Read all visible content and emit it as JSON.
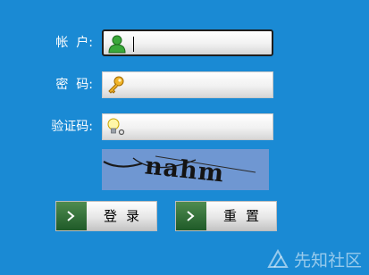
{
  "form": {
    "account_label": "帐  户:",
    "password_label": "密  码:",
    "captcha_label": "验证码:",
    "account_value": "",
    "password_value": "",
    "captcha_value": ""
  },
  "icons": {
    "account": "user-icon",
    "password": "key-icon",
    "captcha": "lightbulb-icon",
    "button": "chevron-right-icon"
  },
  "captcha": {
    "text": "nahm"
  },
  "buttons": {
    "login_label": "登录",
    "reset_label": "重置"
  },
  "watermark": {
    "text": "先知社区"
  },
  "colors": {
    "background": "#1a8ad4",
    "label": "#ffffff",
    "button_tip": "#2f6b35",
    "captcha_bg": "#6f97d2"
  }
}
